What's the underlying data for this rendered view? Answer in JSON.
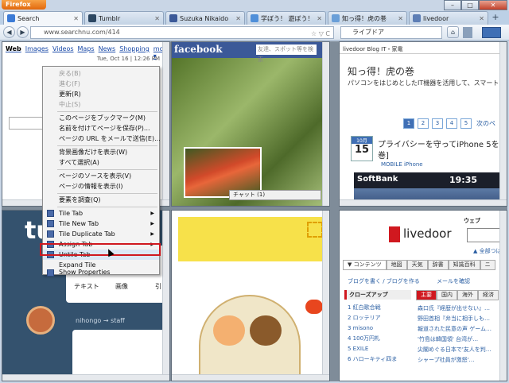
{
  "window": {
    "app_button": "Firefox",
    "minimize": "–",
    "maximize": "□",
    "close": "✕"
  },
  "tabs": [
    {
      "label": "Search",
      "color": "#3c7bd6"
    },
    {
      "label": "Tumblr",
      "color": "#2c4762"
    },
    {
      "label": "Suzuka Nikaido",
      "color": "#3b5998"
    },
    {
      "label": "学ぼう！ 遊ぼう！",
      "color": "#4f8fd9"
    },
    {
      "label": "知っ得！虎の巻",
      "color": "#6a9fd8"
    },
    {
      "label": "livedoor",
      "color": "#5d7eb5"
    }
  ],
  "newtab_label": "+",
  "nav": {
    "back": "◀",
    "forward": "▶",
    "url": "www.searchnu.com/414",
    "url_icons": "☆ ▽ C",
    "search_text": "ライブドア",
    "home": "⌂"
  },
  "search_pane": {
    "links": [
      "Web",
      "Images",
      "Videos",
      "Maps",
      "News",
      "Shopping",
      "more ▾"
    ],
    "timestamp": "Tue, Oct 16 | 12:26 PM"
  },
  "facebook_pane": {
    "logo": "facebook",
    "search_placeholder": "友達、スポット等を検索",
    "chat": "チャット (1)"
  },
  "blog_pane": {
    "brand": "livedoor Blog  IT・家電",
    "title": "知っ得！虎の巻",
    "subtitle": "パソコンをはじめとしたIT機器を活用して、スマートハ",
    "pages": [
      "1",
      "2",
      "3",
      "4",
      "5"
    ],
    "next": "次のペ",
    "date_month": "10月",
    "date_day": "15",
    "headline": "プライバシーを守ってiPhone 5を",
    "headline2": "巻]",
    "category": "MOBILE  iPhone",
    "phone_carrier": "SoftBank",
    "phone_time": "19:35"
  },
  "tumblr_pane": {
    "logo": "tu",
    "labels": [
      "テキスト",
      "画像",
      "引"
    ],
    "user": "nihongo → staff"
  },
  "livedoor_pane": {
    "logo": "livedoor",
    "tab_web": "ウェブ",
    "link_top": "▲ 全部つば",
    "nav": [
      "▼ コンテンツ",
      "地図",
      "天気",
      "辞書",
      "知識百科",
      "ニ"
    ],
    "subnav": "ブログを書く / ブログを作る",
    "mail": "メールを確認",
    "closeup": "クローズアップ",
    "main_tab": "主要",
    "tabs2": [
      "国内",
      "海外",
      "経済"
    ],
    "ranking": [
      "1 紅白歌合戦",
      "2 ロッテリア",
      "3 misono",
      "4 100万円札",
      "5 EXILE",
      "6 ハローキティ四ま"
    ],
    "news": [
      "森口氏『経歴が出せない』…",
      "野田首相『弁当に相手しも…",
      "報道された民意の声 ゲーム…",
      "'竹島は韓国領' 台湾が…",
      "尖閣めぐる日本で'友人を判…",
      "シャープ社員が激怒'…"
    ]
  },
  "menu": {
    "items": [
      "戻る(B)",
      "進む(F)",
      "更新(R)",
      "中止(S)",
      "このページをブックマーク(M)",
      "名前を付けてページを保存(P)...",
      "ページの URL をメールで送信(E)...",
      "背景画像だけを表示(W)",
      "すべて選択(A)",
      "ページのソースを表示(V)",
      "ページの情報を表示(I)",
      "要素を調査(Q)",
      "Tile Tab",
      "Tile New Tab",
      "Tile Duplicate Tab",
      "Assign Tab",
      "Untile Tab",
      "Expand Tile",
      "Show Properties"
    ]
  },
  "accent": "#d0181f"
}
